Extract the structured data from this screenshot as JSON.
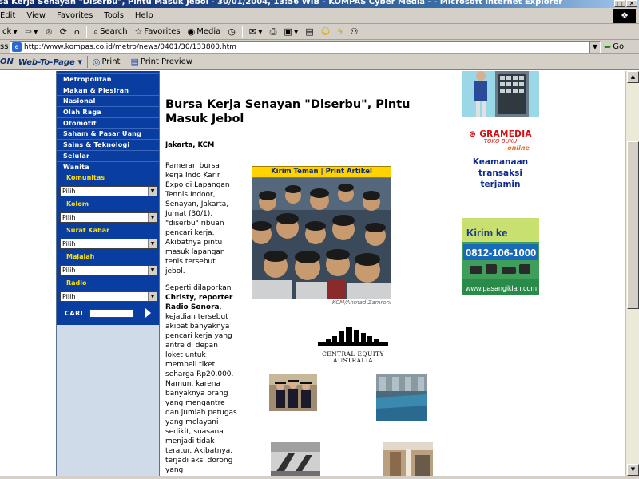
{
  "window": {
    "title": "sa Kerja Senayan \"Diserbu\", Pintu Masuk Jebol - 30/01/2004, 13:56 WIB - KOMPAS Cyber Media - - Microsoft Internet Explorer"
  },
  "menubar": {
    "items": [
      "Edit",
      "View",
      "Favorites",
      "Tools",
      "Help"
    ]
  },
  "toolbar": {
    "back_label": "ck",
    "search_label": "Search",
    "favorites_label": "Favorites",
    "media_label": "Media"
  },
  "address": {
    "label": "ss",
    "url": "http://www.kompas.co.id/metro/news/0401/30/133800.htm",
    "go_label": "Go"
  },
  "linksbar": {
    "brand": "ON",
    "web_to_page": "Web-To-Page",
    "print_label": "Print",
    "print_preview_label": "Print Preview"
  },
  "leftnav": {
    "items": [
      "Metropolitan",
      "Makan & Plesiran",
      "Nasional",
      "Olah Raga",
      "Otomotif",
      "Saham & Pasar Uang",
      "Sains & Teknologi",
      "Selular",
      "Wanita"
    ],
    "sections": [
      {
        "title": "Komunitas",
        "select": "Pilih"
      },
      {
        "title": "Kolom",
        "select": "Pilih"
      },
      {
        "title": "Surat Kabar",
        "select": "Pilih"
      },
      {
        "title": "Majalah",
        "select": "Pilih"
      },
      {
        "title": "Radio",
        "select": "Pilih"
      }
    ],
    "search_label": "CARI"
  },
  "article": {
    "headline": "Bursa Kerja Senayan \"Diserbu\", Pintu Masuk Jebol",
    "dateline": "Jakarta, KCM",
    "para1": "Pameran bursa kerja Indo Karir Expo di Lapangan Tennis Indoor, Senayan, Jakarta, Jumat (30/1), \"diserbu\" ribuan pencari kerja. Akibatnya pintu masuk lapangan tenis tersebut jebol.",
    "para2_lead": "Seperti dilaporkan ",
    "para2_bold": "Christy, reporter Radio Sonora",
    "para2_rest": ", kejadian tersebut akibat banyaknya pencari kerja yang antre di depan loket untuk membeli tiket seharga Rp20.000. Namun, karena banyaknya orang yang mengantre dan jumlah petugas yang melayani sedikit, suasana menjadi tidak teratur. Akibatnya, terjadi aksi dorong yang mengakibatkan",
    "photo_bar": "Kirim Teman | Print Artikel",
    "photo_credit": "KCM/Ahmad Zamroni"
  },
  "ads": {
    "cea_name_line1": "CENTRAL EQUITY",
    "cea_name_line2": "AUSTRALIA",
    "gramedia_logo": "GRAMEDIA",
    "gramedia_sub": "TOKO BUKU",
    "gramedia_online": "online",
    "gramedia_msg": "Keamanaan transaksi terjamin",
    "pasang_kirim": "Kirim ke",
    "pasang_number": "0812-106-1000",
    "pasang_url": "www.pasangiklan.com"
  }
}
